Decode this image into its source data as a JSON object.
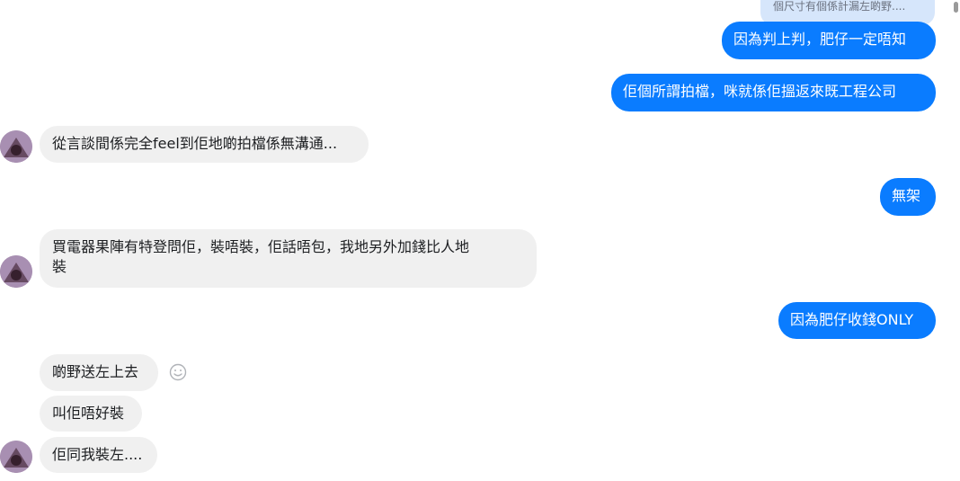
{
  "conversation": {
    "quoted_reply": "個尺寸有個係計漏左啲野....",
    "messages": [
      {
        "side": "out",
        "text": "因為判上判，肥仔一定唔知"
      },
      {
        "side": "out",
        "text": "佢個所謂拍檔，咪就係佢搵返來既工程公司"
      },
      {
        "side": "in",
        "text": "從言談間係完全feel到佢地啲拍檔係無溝通..."
      },
      {
        "side": "out",
        "text": "無架"
      },
      {
        "side": "in",
        "line1": "買電器果陣有特登問佢，裝唔裝，佢話唔包，我地另外加錢比人地",
        "line2": "裝"
      },
      {
        "side": "out",
        "text": "因為肥仔收錢ONLY"
      },
      {
        "side": "in",
        "text": "啲野送左上去"
      },
      {
        "side": "in",
        "text": "叫佢唔好裝"
      },
      {
        "side": "in",
        "text": "佢同我裝左...."
      }
    ]
  },
  "icons": {
    "reaction": "smiley-face-icon",
    "avatar": "contact-avatar"
  },
  "colors": {
    "outgoing_bubble": "#0a7cff",
    "incoming_bubble": "#f0f0f0",
    "quoted_bubble": "#d6e6fb"
  }
}
